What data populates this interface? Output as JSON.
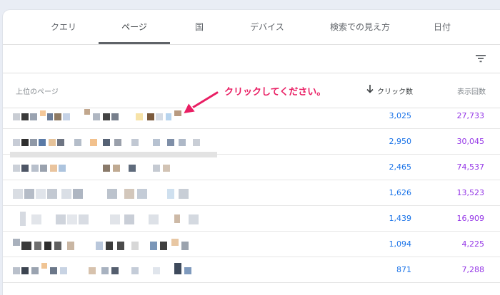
{
  "tabs": [
    {
      "label": "クエリ"
    },
    {
      "label": "ページ"
    },
    {
      "label": "国"
    },
    {
      "label": "デバイス"
    },
    {
      "label": "検索での見え方"
    },
    {
      "label": "日付"
    }
  ],
  "active_tab": "ページ",
  "table": {
    "headers": {
      "page": "上位のページ",
      "clicks": "クリック数",
      "impressions": "表示回数"
    },
    "sort": "clicks-descending",
    "rows": [
      {
        "clicks": "3,025",
        "impressions": "27,733"
      },
      {
        "clicks": "2,950",
        "impressions": "30,045"
      },
      {
        "clicks": "2,465",
        "impressions": "74,537"
      },
      {
        "clicks": "1,626",
        "impressions": "13,523"
      },
      {
        "clicks": "1,439",
        "impressions": "16,909"
      },
      {
        "clicks": "1,094",
        "impressions": "4,225"
      },
      {
        "clicks": "871",
        "impressions": "7,288"
      }
    ]
  },
  "annotation": {
    "text": "クリックしてください。"
  },
  "colors": {
    "clicks": "#1a73e8",
    "impressions": "#9334e6",
    "annotation": "#e91e63"
  },
  "icons": {
    "filter": "filter-icon",
    "sort": "arrow-down-icon",
    "annotation_arrow": "pointer-arrow"
  }
}
